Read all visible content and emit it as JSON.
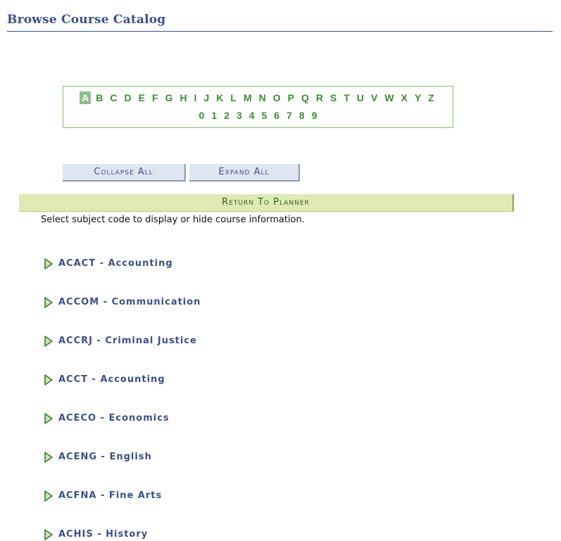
{
  "page": {
    "title": "Browse Course Catalog",
    "instruction": "Select subject code to display or hide course information."
  },
  "alphabet": {
    "letters": [
      "A",
      "B",
      "C",
      "D",
      "E",
      "F",
      "G",
      "H",
      "I",
      "J",
      "K",
      "L",
      "M",
      "N",
      "O",
      "P",
      "Q",
      "R",
      "S",
      "T",
      "U",
      "V",
      "W",
      "X",
      "Y",
      "Z"
    ],
    "digits": [
      "0",
      "1",
      "2",
      "3",
      "4",
      "5",
      "6",
      "7",
      "8",
      "9"
    ],
    "selected": "A"
  },
  "buttons": {
    "collapse_all": "Collapse All",
    "expand_all": "Expand All",
    "return_to_planner": "Return To Planner"
  },
  "subjects": [
    {
      "label": "ACACT - Accounting"
    },
    {
      "label": "ACCOM - Communication"
    },
    {
      "label": "ACCRJ - Criminal Justice"
    },
    {
      "label": "ACCT - Accounting"
    },
    {
      "label": "ACECO - Economics"
    },
    {
      "label": "ACENG - English"
    },
    {
      "label": "ACFNA - Fine Arts"
    },
    {
      "label": "ACHIS - History"
    }
  ],
  "icons": {
    "expand": "triangle-right-icon"
  },
  "colors": {
    "title": "#3d4f87",
    "link_green": "#3e8a3a",
    "return_bar": "#deeab2",
    "button_bg": "#dfe6f2"
  }
}
